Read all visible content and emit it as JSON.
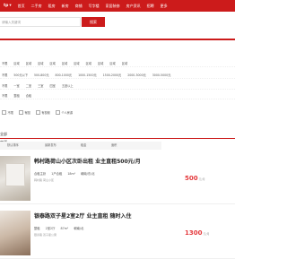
{
  "navbar": {
    "city": "tp",
    "city_arrow": "▾",
    "items": [
      "首页",
      "二手房",
      "租房",
      "新房",
      "商铺",
      "写字楼",
      "家居装修",
      "房产资讯",
      "招聘",
      "更多"
    ]
  },
  "search": {
    "placeholder": "请输入关键词",
    "button": "搜索"
  },
  "filters": {
    "area_options": [
      "不限",
      "区域",
      "区域",
      "区域",
      "区域",
      "区域",
      "区域",
      "区域",
      "区域",
      "区域",
      "区域"
    ],
    "price_options": [
      "不限",
      "500元以下",
      "500-800元",
      "800-1000元",
      "1000-1500元",
      "1500-2000元",
      "2000-3000元",
      "3000-5000元"
    ],
    "room_options": [
      "不限",
      "一室",
      "二室",
      "三室",
      "四室",
      "五室以上"
    ],
    "type_options": [
      "不限",
      "整租",
      "合租"
    ],
    "checkboxes": [
      "不限",
      "有图",
      "有视频",
      "个人房源"
    ]
  },
  "tabs": {
    "active": "全部房源"
  },
  "sortbar": {
    "items": [
      "默认排序",
      "最新发布",
      "租金",
      "面积"
    ]
  },
  "listings": [
    {
      "title": "韩村路荷山小区次卧出租 业主直租500元/月",
      "meta": [
        "合租主卧",
        "1户合租",
        "18m²",
        "朝南/东/北"
      ],
      "address": "韩村路 荷山小区",
      "price": "500",
      "unit": "元/月"
    },
    {
      "title": "银泰路双子星2室2厅 业主直租 随时入住",
      "meta": [
        "整租",
        "2室2厅",
        "87m²",
        "朝南/北"
      ],
      "address": "银泰路 双子星公寓",
      "price": "1300",
      "unit": "元/月"
    }
  ]
}
